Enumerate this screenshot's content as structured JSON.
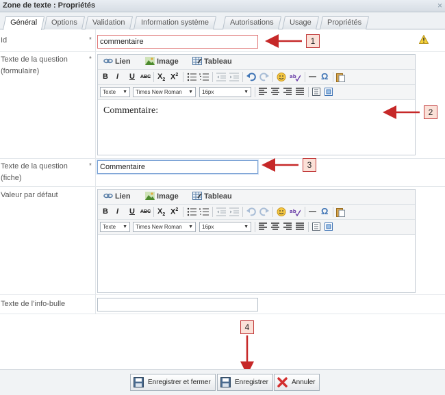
{
  "window": {
    "title": "Zone de texte : Propriétés",
    "close": "×"
  },
  "tabs": [
    {
      "label": "Général",
      "active": true
    },
    {
      "label": "Options"
    },
    {
      "label": "Validation"
    },
    {
      "label": "Information système"
    },
    {
      "label": "Autorisations"
    },
    {
      "label": "Usage"
    },
    {
      "label": "Propriétés"
    }
  ],
  "form": {
    "id": {
      "label": "Id",
      "required": "*",
      "value": "commentaire"
    },
    "question_form": {
      "label": "Texte de la question (formulaire)",
      "required": "*",
      "content": "Commentaire:"
    },
    "question_fiche": {
      "label": "Texte de la question (fiche)",
      "required": "*",
      "value": "Commentaire"
    },
    "default_value": {
      "label": "Valeur par défaut",
      "content": ""
    },
    "tooltip": {
      "label": "Texte de l’info-bulle",
      "value": ""
    }
  },
  "editor": {
    "insert": {
      "link": "Lien",
      "image": "Image",
      "table": "Tableau"
    },
    "format": {
      "bold": "B",
      "italic": "I",
      "underline": "U",
      "strike": "ABC",
      "sub": "X",
      "sub_mark": "2",
      "sup": "X",
      "sup_mark": "2",
      "hr": "—",
      "omega": "Ω"
    },
    "selects": {
      "style": "Texte",
      "font": "Times New Roman",
      "size": "16px"
    }
  },
  "callouts": [
    "1",
    "2",
    "3",
    "4"
  ],
  "footer": {
    "save_close": "Enregistrer et fermer",
    "save": "Enregistrer",
    "cancel": "Annuler"
  },
  "colors": {
    "accent_red": "#c23b3b",
    "callout_fill": "#fbe1d8",
    "title_bar": "#dfe5ea"
  }
}
